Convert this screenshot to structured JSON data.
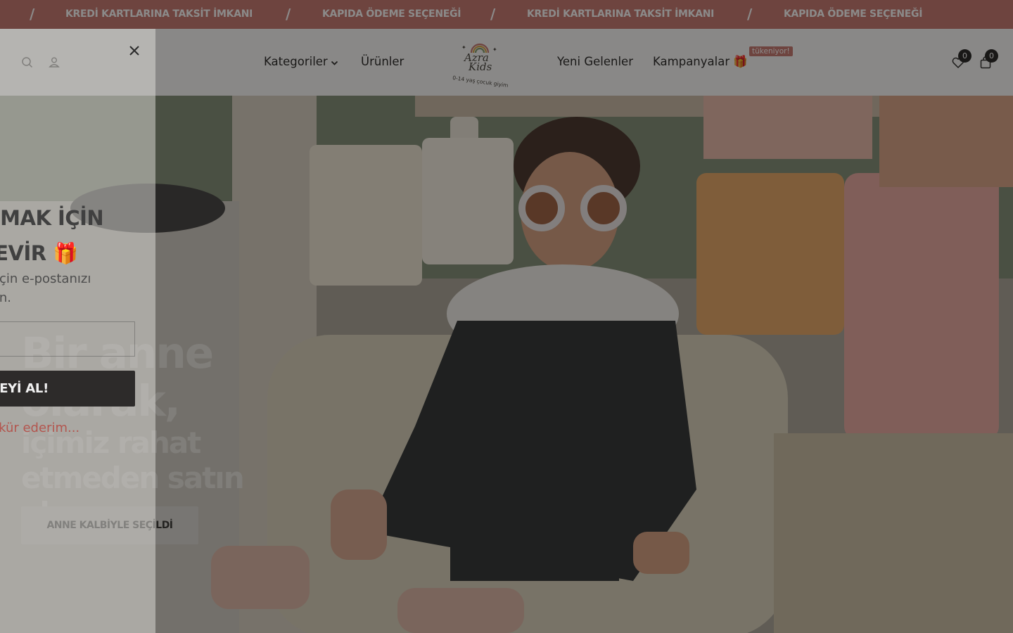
{
  "announcement": {
    "separator": "/",
    "messages": [
      "KREDİ KARTLARINA TAKSİT İMKANI",
      "KAPIDA ÖDEME SEÇENEĞİ",
      "KREDİ KARTLARINA TAKSİT İMKANI",
      "KAPIDA ÖDEME SEÇENEĞİ"
    ],
    "bg_color": "#c5726b"
  },
  "header": {
    "icons_left": [
      "search-icon",
      "account-icon"
    ],
    "nav_left": [
      {
        "label": "Kategoriler",
        "has_dropdown": true
      },
      {
        "label": "Ürünler"
      }
    ],
    "logo": {
      "line1": "Azra",
      "line2": "Kids",
      "tagline": "0-14 yaş çocuk giyim"
    },
    "nav_right": [
      {
        "label": "Yeni Gelenler"
      },
      {
        "label": "Kampanyalar 🎁",
        "badge": "tükeniyor!"
      }
    ],
    "wishlist_count": "0",
    "cart_count": "0"
  },
  "hero": {
    "title_line1": "Bir anne",
    "title_line2": "olarak,",
    "title_line3": "içimiz rahat",
    "title_line4": "etmeden satın",
    "title_line5": "almayız.",
    "button_label": "ANNE KALBİYLE SEÇİLDİ"
  },
  "popup": {
    "title_line1": "KAZANMAK İÇİN",
    "title_line2": "ÇARKI ÇEVİR 🎁",
    "subtitle_line1": "Şansı için e-postanızı",
    "subtitle_line2": "girin.",
    "email_placeholder": "",
    "submit_label": "HEDİYEYİ AL!",
    "thanks": "Hayır, teşekkür ederim..."
  },
  "colors": {
    "accent": "#c5726b",
    "header_bg": "#fbfbfb",
    "text_dark": "#1a1a1a"
  }
}
